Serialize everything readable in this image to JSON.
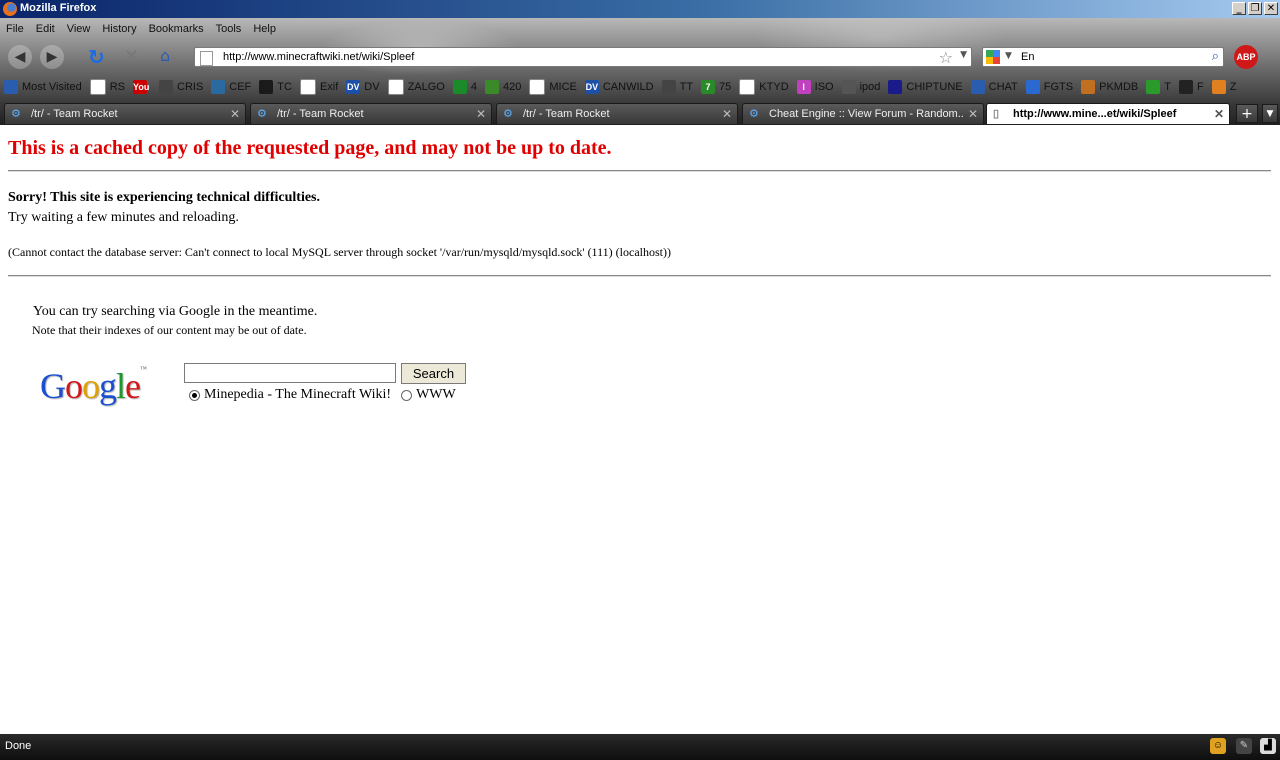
{
  "window": {
    "title": "Mozilla Firefox"
  },
  "menu": [
    "File",
    "Edit",
    "View",
    "History",
    "Bookmarks",
    "Tools",
    "Help"
  ],
  "address": {
    "url": "http://www.minecraftwiki.net/wiki/Spleef"
  },
  "search": {
    "value": "En"
  },
  "addon": {
    "abp_label": "ABP"
  },
  "bookmarks": [
    {
      "label": "Most Visited",
      "color": "#2a5db0",
      "icon": "globe-icon"
    },
    {
      "label": "RS",
      "color": "#ffffff",
      "icon": "page-icon"
    },
    {
      "label": "",
      "color": "#cc0000",
      "icon": "youtube-icon",
      "glyph": "You"
    },
    {
      "label": "CRIS",
      "color": "#444444",
      "icon": "face-icon"
    },
    {
      "label": "CEF",
      "color": "#2a6aa0",
      "icon": "gear-icon"
    },
    {
      "label": "TC",
      "color": "#1a1a1a",
      "icon": "tc-icon"
    },
    {
      "label": "Exif",
      "color": "#ffffff",
      "icon": "page-icon"
    },
    {
      "label": "DV",
      "color": "#1c4fa8",
      "icon": "dv-icon",
      "glyph": "DV"
    },
    {
      "label": "ZALGO",
      "color": "#ffffff",
      "icon": "page-icon"
    },
    {
      "label": "4",
      "color": "#1a8a2a",
      "icon": "alien-icon"
    },
    {
      "label": "420",
      "color": "#3a8a2a",
      "icon": "leaf-icon"
    },
    {
      "label": "MICE",
      "color": "#ffffff",
      "icon": "page-icon"
    },
    {
      "label": "CANWILD",
      "color": "#1c4fa8",
      "icon": "dv-icon",
      "glyph": "DV"
    },
    {
      "label": "TT",
      "color": "#444444",
      "icon": "tt-icon"
    },
    {
      "label": "75",
      "color": "#2a8a2a",
      "icon": "seven-icon",
      "glyph": "7"
    },
    {
      "label": "KTYD",
      "color": "#ffffff",
      "icon": "page-icon"
    },
    {
      "label": "ISO",
      "color": "#c040c0",
      "icon": "iso-icon",
      "glyph": "I"
    },
    {
      "label": "ipod",
      "color": "#555555",
      "icon": "ipod-icon"
    },
    {
      "label": "CHIPTUNE",
      "color": "#1a1a8a",
      "icon": "chiptune-icon"
    },
    {
      "label": "CHAT",
      "color": "#2a5db0",
      "icon": "chat-icon"
    },
    {
      "label": "FGTS",
      "color": "#2a6ad0",
      "icon": "fgts-icon"
    },
    {
      "label": "PKMDB",
      "color": "#c07020",
      "icon": "pkmdb-icon"
    },
    {
      "label": "T",
      "color": "#2a9a2a",
      "icon": "clover-icon"
    },
    {
      "label": "F",
      "color": "#222222",
      "icon": "f-icon"
    },
    {
      "label": "Z",
      "color": "#e08020",
      "icon": "cart-icon"
    }
  ],
  "tabs": [
    {
      "label": "/tr/ - Team Rocket",
      "active": false
    },
    {
      "label": "/tr/ - Team Rocket",
      "active": false
    },
    {
      "label": "/tr/ - Team Rocket",
      "active": false
    },
    {
      "label": "Cheat Engine :: View Forum - Random...",
      "active": false
    },
    {
      "label": "http://www.mine...et/wiki/Spleef",
      "active": true
    }
  ],
  "page": {
    "cache_notice": "This is a cached copy of the requested page, and may not be up to date.",
    "error_title": "Sorry! This site is experiencing technical difficulties.",
    "error_sub": "Try waiting a few minutes and reloading.",
    "error_detail": "(Cannot contact the database server: Can't connect to local MySQL server through socket '/var/run/mysqld/mysqld.sock' (111) (localhost))",
    "google_intro": "You can try searching via Google in the meantime.",
    "google_note": "Note that their indexes of our content may be out of date.",
    "search_button": "Search",
    "radio_site": "Minepedia - The Minecraft Wiki!",
    "radio_www": "WWW",
    "radio_selected": "site"
  },
  "status": {
    "text": "Done"
  }
}
